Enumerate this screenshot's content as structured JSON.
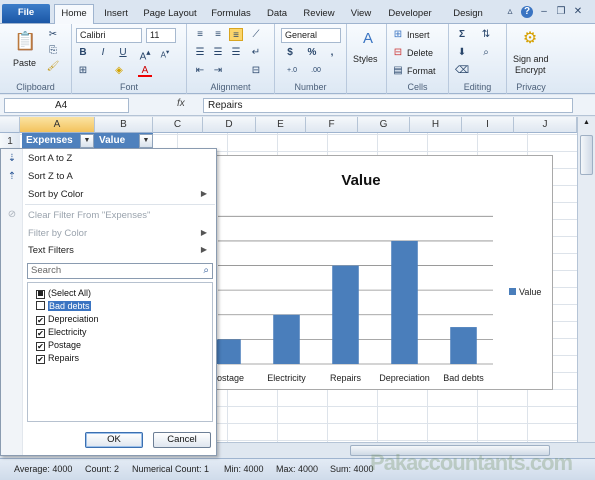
{
  "tabs": [
    "File",
    "Home",
    "Insert",
    "Page Layout",
    "Formulas",
    "Data",
    "Review",
    "View",
    "Developer",
    "Design"
  ],
  "ribbon": {
    "clipboard": {
      "paste": "Paste",
      "label": "Clipboard"
    },
    "font": {
      "name": "Calibri",
      "size": "11",
      "bold": "B",
      "italic": "I",
      "underline": "U",
      "label": "Font"
    },
    "alignment": {
      "label": "Alignment"
    },
    "number": {
      "format": "General",
      "currency": "$",
      "percent": "%",
      "comma": ",",
      "inc": "+.0",
      "dec": ".00",
      "label": "Number"
    },
    "styles": {
      "label": "Styles"
    },
    "cells": {
      "insert": "Insert",
      "delete": "Delete",
      "format": "Format",
      "label": "Cells"
    },
    "editing": {
      "sum": "Σ",
      "label": "Editing"
    },
    "privacy": {
      "sign1": "Sign and",
      "sign2": "Encrypt",
      "label": "Privacy"
    }
  },
  "formula_bar": {
    "cell": "A4",
    "fx": "fx",
    "value": "Repairs"
  },
  "columns": [
    "A",
    "B",
    "C",
    "D",
    "E",
    "F",
    "G",
    "H",
    "I",
    "J"
  ],
  "row_numbers": [
    "1"
  ],
  "header_cells": [
    "Expenses",
    "Value"
  ],
  "filter_menu": {
    "sort_az": "Sort A to Z",
    "sort_za": "Sort Z to A",
    "sort_color": "Sort by Color",
    "clear_filter": "Clear Filter From \"Expenses\"",
    "filter_color": "Filter by Color",
    "text_filters": "Text Filters",
    "search_placeholder": "Search",
    "items": [
      {
        "label": "(Select All)",
        "state": "mixed"
      },
      {
        "label": "Bad debts",
        "state": "unchecked"
      },
      {
        "label": "Depreciation",
        "state": "checked"
      },
      {
        "label": "Electricity",
        "state": "checked"
      },
      {
        "label": "Postage",
        "state": "checked"
      },
      {
        "label": "Repairs",
        "state": "checked"
      }
    ],
    "ok": "OK",
    "cancel": "Cancel"
  },
  "chart_data": {
    "type": "bar",
    "title": "Value",
    "categories": [
      "Postage",
      "Electricity",
      "Repairs",
      "Depreciation",
      "Bad debts"
    ],
    "series": [
      {
        "name": "Value",
        "values": [
          200,
          400,
          800,
          1000,
          300
        ]
      }
    ],
    "ylim": [
      0,
      1300
    ],
    "color": "#4a7ebb",
    "legend": "right",
    "grid": true
  },
  "status_bar": {
    "average": "Average: 4000",
    "count": "Count: 2",
    "numerical_count": "Numerical Count: 1",
    "min": "Min: 4000",
    "max": "Max: 4000",
    "sum": "Sum: 4000"
  },
  "watermark": "Pakaccountants.com"
}
